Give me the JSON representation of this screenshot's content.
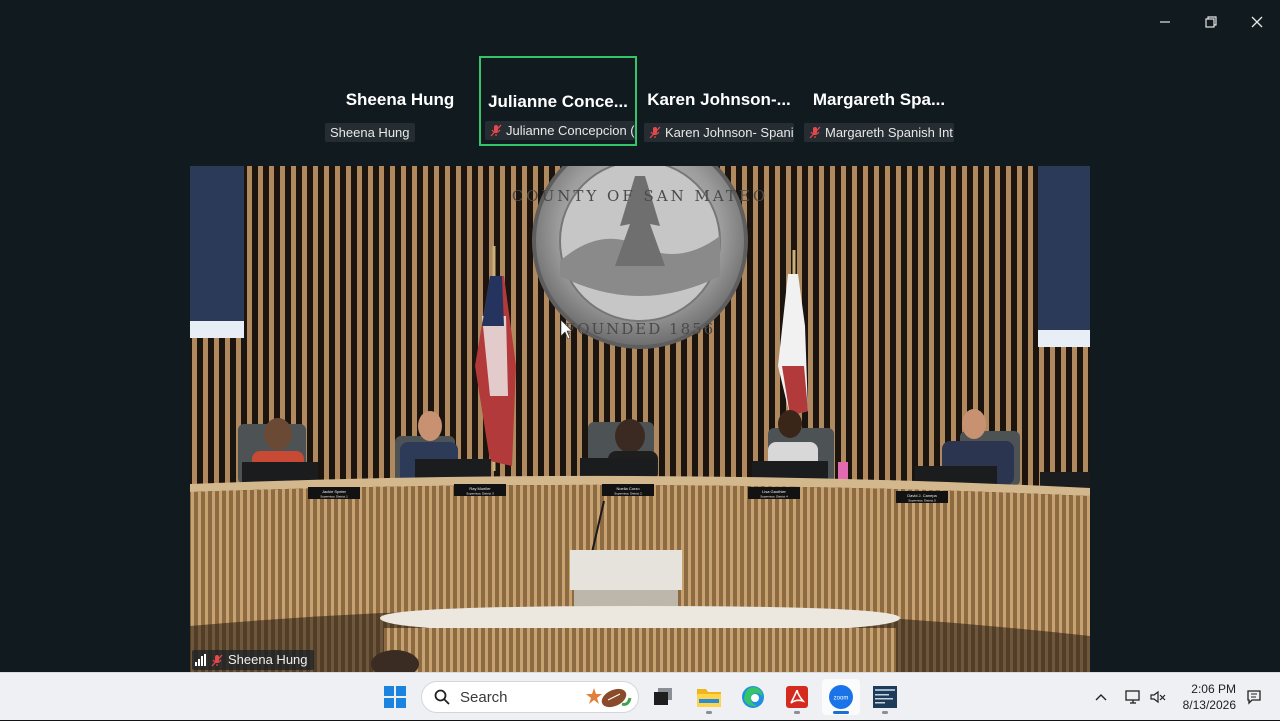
{
  "window": {
    "controls": [
      "minimize-icon",
      "restore-icon",
      "close-icon"
    ]
  },
  "participants": [
    {
      "display_name": "Sheena Hung",
      "tag": "Sheena Hung",
      "muted": false,
      "active": false
    },
    {
      "display_name": "Julianne  Conce...",
      "tag": "Julianne Concepcion (...",
      "muted": true,
      "active": true
    },
    {
      "display_name": "Karen  Johnson-...",
      "tag": "Karen Johnson- Spani...",
      "muted": true,
      "active": false
    },
    {
      "display_name": "Margareth  Spa...",
      "tag": "Margareth Spanish Int...",
      "muted": true,
      "active": false
    }
  ],
  "main_video": {
    "speaker_tag": "Sheena Hung",
    "seal_top_text": "COUNTY OF SAN MATEO",
    "seal_bottom_text": "FOUNDED 1856",
    "nameplates": [
      "Jackie Speier",
      "Ray Mueller",
      "Noelia Corzo",
      "Lisa Gauthier",
      "David J. Canepa"
    ],
    "nameplate_sublabels": [
      "Supervisor, District 1",
      "Supervisor, District 3",
      "Supervisor, District 2",
      "Supervisor, District 4",
      "Supervisor, District 5"
    ]
  },
  "taskbar": {
    "search_placeholder": "Search",
    "apps": [
      "windows-start-icon",
      "task-view-icon",
      "file-explorer-icon",
      "edge-browser-icon",
      "acrobat-icon",
      "zoom-icon",
      "meeting-app-icon"
    ],
    "time": "2:06 PM",
    "date": "8/13/2026"
  },
  "colors": {
    "active_speaker_border": "#35c46a",
    "mic_muted": "#e5484d",
    "taskbar_accent": "#1b6fd3"
  }
}
